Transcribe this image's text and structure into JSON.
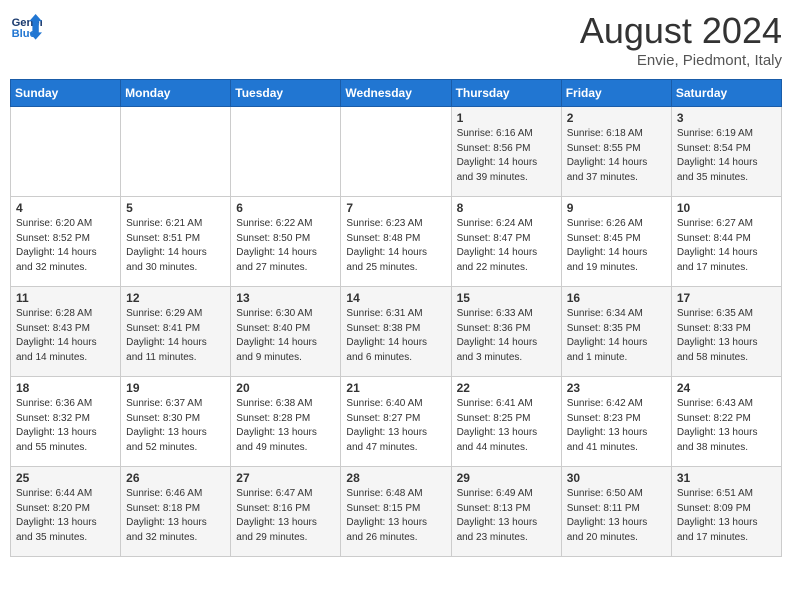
{
  "header": {
    "logo_line1": "General",
    "logo_line2": "Blue",
    "month": "August 2024",
    "location": "Envie, Piedmont, Italy"
  },
  "days_of_week": [
    "Sunday",
    "Monday",
    "Tuesday",
    "Wednesday",
    "Thursday",
    "Friday",
    "Saturday"
  ],
  "weeks": [
    [
      {
        "day": "",
        "info": ""
      },
      {
        "day": "",
        "info": ""
      },
      {
        "day": "",
        "info": ""
      },
      {
        "day": "",
        "info": ""
      },
      {
        "day": "1",
        "info": "Sunrise: 6:16 AM\nSunset: 8:56 PM\nDaylight: 14 hours and 39 minutes."
      },
      {
        "day": "2",
        "info": "Sunrise: 6:18 AM\nSunset: 8:55 PM\nDaylight: 14 hours and 37 minutes."
      },
      {
        "day": "3",
        "info": "Sunrise: 6:19 AM\nSunset: 8:54 PM\nDaylight: 14 hours and 35 minutes."
      }
    ],
    [
      {
        "day": "4",
        "info": "Sunrise: 6:20 AM\nSunset: 8:52 PM\nDaylight: 14 hours and 32 minutes."
      },
      {
        "day": "5",
        "info": "Sunrise: 6:21 AM\nSunset: 8:51 PM\nDaylight: 14 hours and 30 minutes."
      },
      {
        "day": "6",
        "info": "Sunrise: 6:22 AM\nSunset: 8:50 PM\nDaylight: 14 hours and 27 minutes."
      },
      {
        "day": "7",
        "info": "Sunrise: 6:23 AM\nSunset: 8:48 PM\nDaylight: 14 hours and 25 minutes."
      },
      {
        "day": "8",
        "info": "Sunrise: 6:24 AM\nSunset: 8:47 PM\nDaylight: 14 hours and 22 minutes."
      },
      {
        "day": "9",
        "info": "Sunrise: 6:26 AM\nSunset: 8:45 PM\nDaylight: 14 hours and 19 minutes."
      },
      {
        "day": "10",
        "info": "Sunrise: 6:27 AM\nSunset: 8:44 PM\nDaylight: 14 hours and 17 minutes."
      }
    ],
    [
      {
        "day": "11",
        "info": "Sunrise: 6:28 AM\nSunset: 8:43 PM\nDaylight: 14 hours and 14 minutes."
      },
      {
        "day": "12",
        "info": "Sunrise: 6:29 AM\nSunset: 8:41 PM\nDaylight: 14 hours and 11 minutes."
      },
      {
        "day": "13",
        "info": "Sunrise: 6:30 AM\nSunset: 8:40 PM\nDaylight: 14 hours and 9 minutes."
      },
      {
        "day": "14",
        "info": "Sunrise: 6:31 AM\nSunset: 8:38 PM\nDaylight: 14 hours and 6 minutes."
      },
      {
        "day": "15",
        "info": "Sunrise: 6:33 AM\nSunset: 8:36 PM\nDaylight: 14 hours and 3 minutes."
      },
      {
        "day": "16",
        "info": "Sunrise: 6:34 AM\nSunset: 8:35 PM\nDaylight: 14 hours and 1 minute."
      },
      {
        "day": "17",
        "info": "Sunrise: 6:35 AM\nSunset: 8:33 PM\nDaylight: 13 hours and 58 minutes."
      }
    ],
    [
      {
        "day": "18",
        "info": "Sunrise: 6:36 AM\nSunset: 8:32 PM\nDaylight: 13 hours and 55 minutes."
      },
      {
        "day": "19",
        "info": "Sunrise: 6:37 AM\nSunset: 8:30 PM\nDaylight: 13 hours and 52 minutes."
      },
      {
        "day": "20",
        "info": "Sunrise: 6:38 AM\nSunset: 8:28 PM\nDaylight: 13 hours and 49 minutes."
      },
      {
        "day": "21",
        "info": "Sunrise: 6:40 AM\nSunset: 8:27 PM\nDaylight: 13 hours and 47 minutes."
      },
      {
        "day": "22",
        "info": "Sunrise: 6:41 AM\nSunset: 8:25 PM\nDaylight: 13 hours and 44 minutes."
      },
      {
        "day": "23",
        "info": "Sunrise: 6:42 AM\nSunset: 8:23 PM\nDaylight: 13 hours and 41 minutes."
      },
      {
        "day": "24",
        "info": "Sunrise: 6:43 AM\nSunset: 8:22 PM\nDaylight: 13 hours and 38 minutes."
      }
    ],
    [
      {
        "day": "25",
        "info": "Sunrise: 6:44 AM\nSunset: 8:20 PM\nDaylight: 13 hours and 35 minutes."
      },
      {
        "day": "26",
        "info": "Sunrise: 6:46 AM\nSunset: 8:18 PM\nDaylight: 13 hours and 32 minutes."
      },
      {
        "day": "27",
        "info": "Sunrise: 6:47 AM\nSunset: 8:16 PM\nDaylight: 13 hours and 29 minutes."
      },
      {
        "day": "28",
        "info": "Sunrise: 6:48 AM\nSunset: 8:15 PM\nDaylight: 13 hours and 26 minutes."
      },
      {
        "day": "29",
        "info": "Sunrise: 6:49 AM\nSunset: 8:13 PM\nDaylight: 13 hours and 23 minutes."
      },
      {
        "day": "30",
        "info": "Sunrise: 6:50 AM\nSunset: 8:11 PM\nDaylight: 13 hours and 20 minutes."
      },
      {
        "day": "31",
        "info": "Sunrise: 6:51 AM\nSunset: 8:09 PM\nDaylight: 13 hours and 17 minutes."
      }
    ]
  ]
}
